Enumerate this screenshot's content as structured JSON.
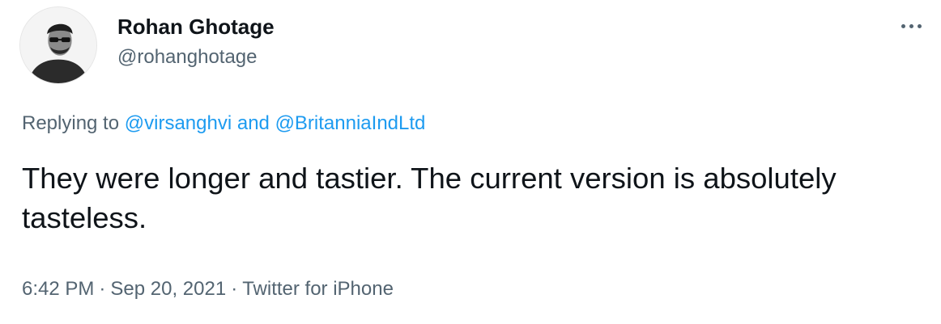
{
  "author": {
    "display_name": "Rohan Ghotage",
    "handle": "@rohanghotage"
  },
  "more_icon": "more-horizontal-icon",
  "reply": {
    "prefix": "Replying to",
    "mention1": "@virsanghvi",
    "conjunction": "and",
    "mention2": "@BritanniaIndLtd"
  },
  "tweet": {
    "text": "They were longer and tastier. The current version is absolutely tasteless."
  },
  "meta": {
    "time": "6:42 PM",
    "separator": "·",
    "date": "Sep 20, 2021",
    "source": "Twitter for iPhone"
  },
  "colors": {
    "link": "#1d9bf0",
    "secondary_text": "#536471",
    "primary_text": "#0f1419"
  }
}
